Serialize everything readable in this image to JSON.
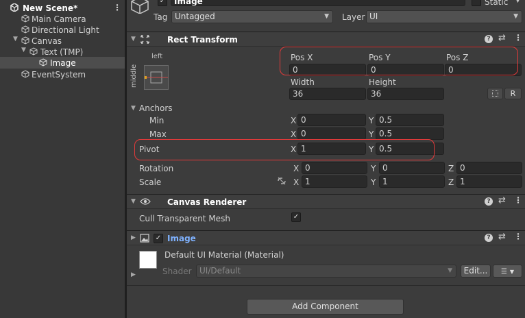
{
  "hierarchy": {
    "scene_name": "New Scene*",
    "items": [
      {
        "label": "Main Camera"
      },
      {
        "label": "Directional Light"
      },
      {
        "label": "Canvas"
      },
      {
        "label": "Text (TMP)"
      },
      {
        "label": "Image"
      },
      {
        "label": "EventSystem"
      }
    ]
  },
  "inspector": {
    "object_name": "Image",
    "static_label": "Static",
    "tag_label": "Tag",
    "tag_value": "Untagged",
    "layer_label": "Layer",
    "layer_value": "UI"
  },
  "rect_transform": {
    "title": "Rect Transform",
    "anchor_preset_top": "left",
    "anchor_preset_side": "middle",
    "pos_x_label": "Pos X",
    "pos_y_label": "Pos Y",
    "pos_z_label": "Pos Z",
    "pos_x": "0",
    "pos_y": "0",
    "pos_z": "0",
    "width_label": "Width",
    "height_label": "Height",
    "width": "36",
    "height": "36",
    "r_button": "R",
    "anchors_label": "Anchors",
    "min_label": "Min",
    "max_label": "Max",
    "x_label": "X",
    "y_label": "Y",
    "z_label": "Z",
    "min_x": "0",
    "min_y": "0.5",
    "max_x": "0",
    "max_y": "0.5",
    "pivot_label": "Pivot",
    "pivot_x": "1",
    "pivot_y": "0.5",
    "rotation_label": "Rotation",
    "rot_x": "0",
    "rot_y": "0",
    "rot_z": "0",
    "scale_label": "Scale",
    "scale_x": "1",
    "scale_y": "1",
    "scale_z": "1"
  },
  "canvas_renderer": {
    "title": "Canvas Renderer",
    "cull_label": "Cull Transparent Mesh",
    "cull_checked": true
  },
  "image_component": {
    "title": "Image",
    "material_name": "Default UI Material (Material)",
    "shader_label": "Shader",
    "shader_value": "UI/Default",
    "edit_button": "Edit...",
    "list_icon": "☰"
  },
  "add_component_label": "Add Component",
  "colors": {
    "highlight_box": "#e53a3a",
    "component_title_blue": "#7fb2ff",
    "selected_row": "#4d4d4d"
  }
}
